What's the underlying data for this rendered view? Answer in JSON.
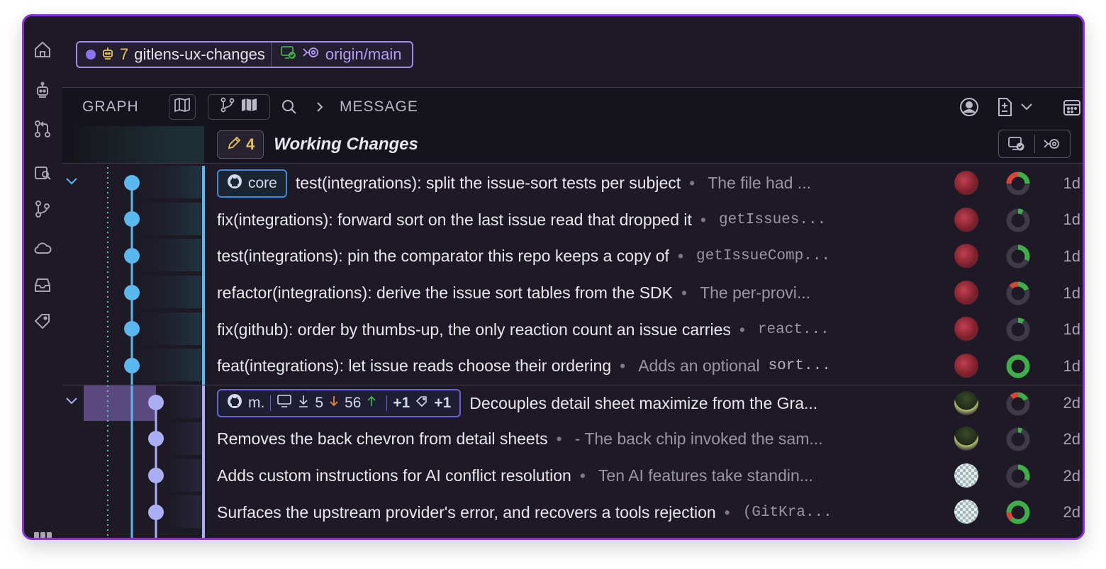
{
  "branch": {
    "worktree_count": "7",
    "name": "gitlens-ux-changes",
    "upstream": "origin/main"
  },
  "header": {
    "graph_label": "GRAPH",
    "message_label": "MESSAGE"
  },
  "working_changes": {
    "count": "4",
    "label": "Working Changes"
  },
  "ref_chip_core": "core",
  "ref_chip_m": {
    "name": "m.",
    "behind": "5",
    "ahead_down": "56",
    "plus_branches": "+1",
    "plus_tags": "+1"
  },
  "commits": [
    {
      "message": "test(integrations): split the issue-sort tests per subject",
      "desc": "The file had ...",
      "desc_mono": false,
      "age": "1d"
    },
    {
      "message": "fix(integrations): forward sort on the last issue read that dropped it",
      "desc": "getIssues...",
      "desc_mono": true,
      "age": "1d"
    },
    {
      "message": "test(integrations): pin the comparator this repo keeps a copy of",
      "desc": "getIssueComp...",
      "desc_mono": true,
      "age": "1d"
    },
    {
      "message": "refactor(integrations): derive the issue sort tables from the SDK",
      "desc": "The per-provi...",
      "desc_mono": false,
      "age": "1d"
    },
    {
      "message": "fix(github): order by thumbs-up, the only reaction count an issue carries",
      "desc": "react...",
      "desc_mono": true,
      "age": "1d"
    },
    {
      "message": "feat(integrations): let issue reads choose their ordering",
      "desc": "Adds an optional",
      "desc_mono_tail": "sort...",
      "age": "1d"
    },
    {
      "message": "Decouples detail sheet maximize from the Gra...",
      "desc": "",
      "age": "2d"
    },
    {
      "message": "Removes the back chevron from detail sheets",
      "desc": "- The back chip invoked the sam...",
      "desc_mono": false,
      "age": "2d"
    },
    {
      "message": "Adds custom instructions for AI conflict resolution",
      "desc": "Ten AI features take standin...",
      "desc_mono": false,
      "age": "2d"
    },
    {
      "message": "Surfaces the upstream provider's error, and recovers a tools rejection",
      "desc": "(GitKra...",
      "desc_mono": true,
      "age": "2d"
    }
  ],
  "colors": {
    "accent_purple": "#8b2fe0",
    "lane_blue": "#5ab8ee",
    "lane_lavender": "#a9aef5",
    "donut_green": "#3fae4a",
    "donut_red": "#d9453b"
  }
}
